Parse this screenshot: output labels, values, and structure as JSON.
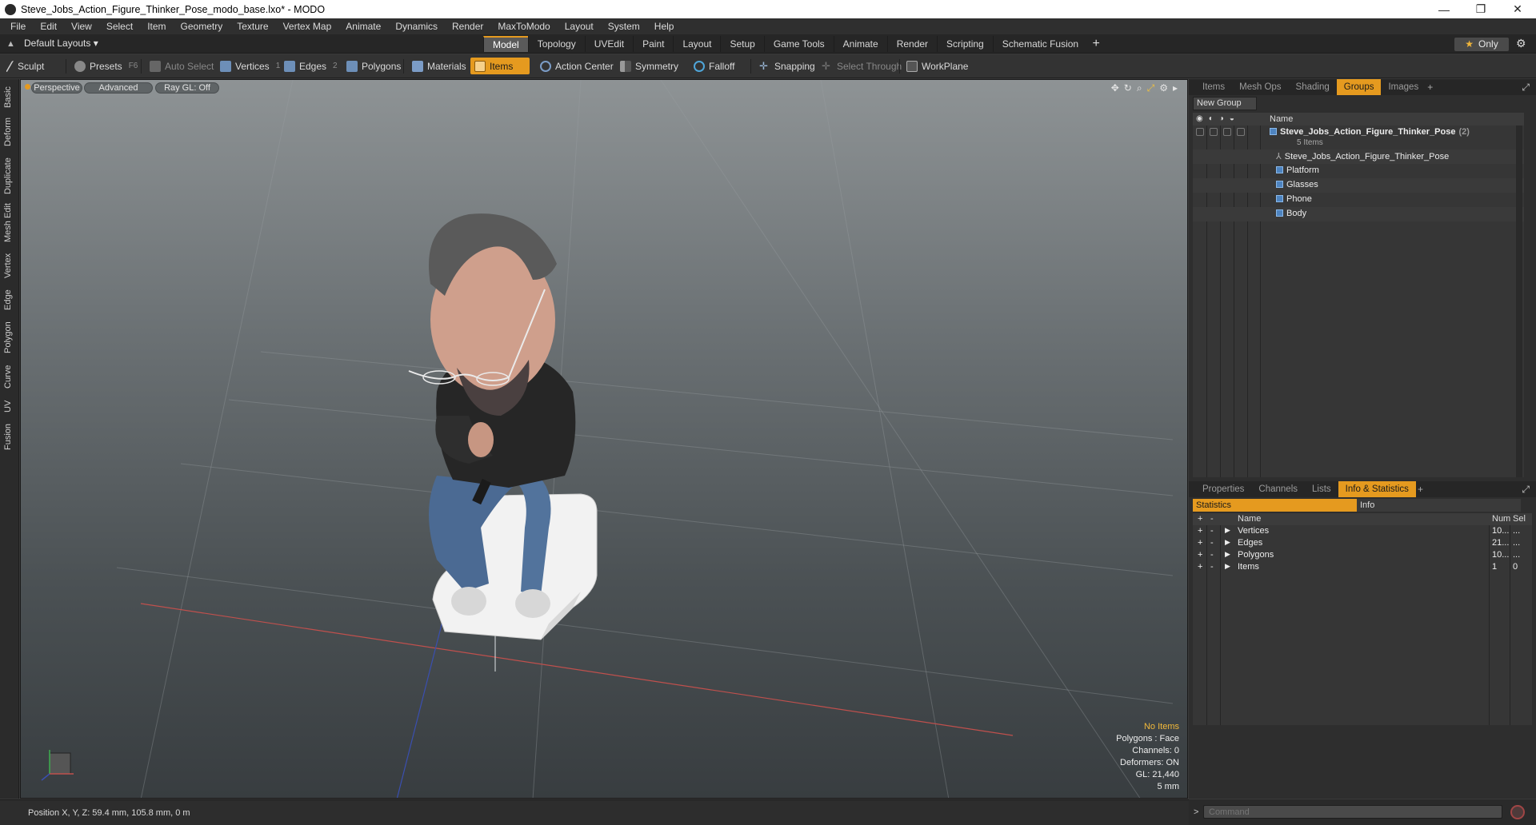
{
  "window": {
    "title": "Steve_Jobs_Action_Figure_Thinker_Pose_modo_base.lxo* - MODO",
    "controls": [
      "—",
      "❐",
      "✕"
    ]
  },
  "menu": [
    "File",
    "Edit",
    "View",
    "Select",
    "Item",
    "Geometry",
    "Texture",
    "Vertex Map",
    "Animate",
    "Dynamics",
    "Render",
    "MaxToModo",
    "Layout",
    "System",
    "Help"
  ],
  "layoutbar": {
    "layout_selector": "Default Layouts ▾",
    "tabs": [
      "Model",
      "Topology",
      "UVEdit",
      "Paint",
      "Layout",
      "Setup",
      "Game Tools",
      "Animate",
      "Render",
      "Scripting",
      "Schematic Fusion"
    ],
    "active_tab": "Model",
    "only_label": "Only"
  },
  "toolbar": {
    "sculpt": "Sculpt",
    "presets": "Presets",
    "presets_hotkey": "F6",
    "auto_select": "Auto Select",
    "vertices": "Vertices",
    "vertices_hotkey": "1",
    "edges": "Edges",
    "edges_hotkey": "2",
    "polygons": "Polygons",
    "materials": "Materials",
    "items": "Items",
    "action_center": "Action Center",
    "symmetry": "Symmetry",
    "falloff": "Falloff",
    "snapping": "Snapping",
    "select_through": "Select Through",
    "workplane": "WorkPlane"
  },
  "left_tabs": [
    "Basic",
    "Deform",
    "Duplicate",
    "Mesh Edit",
    "Vertex",
    "Edge",
    "Polygon",
    "Curve",
    "UV",
    "Fusion"
  ],
  "viewport": {
    "view_mode": "Perspective",
    "shading": "Advanced",
    "raygl": "Ray GL: Off",
    "hud": {
      "selection": "No Items",
      "polygons": "Polygons : Face",
      "channels": "Channels: 0",
      "deformers": "Deformers: ON",
      "gl": "GL: 21,440",
      "grid": "5 mm"
    }
  },
  "status": {
    "position": "Position X, Y, Z:   59.4 mm, 105.8 mm, 0 m"
  },
  "items_panel": {
    "tabs": [
      "Items",
      "Mesh Ops",
      "Shading",
      "Groups",
      "Images"
    ],
    "active_tab": "Groups",
    "new_group": "New Group",
    "column_name": "Name",
    "group": {
      "name": "Steve_Jobs_Action_Figure_Thinker_Pose",
      "count": "(2)",
      "sub": "5 Items"
    },
    "children": [
      "Steve_Jobs_Action_Figure_Thinker_Pose",
      "Platform",
      "Glasses",
      "Phone",
      "Body"
    ]
  },
  "stats_panel": {
    "tabs": [
      "Properties",
      "Channels",
      "Lists",
      "Info & Statistics"
    ],
    "active_tab": "Info & Statistics",
    "subtabs": [
      "Statistics",
      "Info"
    ],
    "columns": {
      "name": "Name",
      "num": "Num",
      "sel": "Sel"
    },
    "rows": [
      {
        "name": "Vertices",
        "num": "10...",
        "sel": "..."
      },
      {
        "name": "Edges",
        "num": "21...",
        "sel": "..."
      },
      {
        "name": "Polygons",
        "num": "10...",
        "sel": "..."
      },
      {
        "name": "Items",
        "num": "1",
        "sel": "0"
      }
    ]
  },
  "command": {
    "placeholder": "Command",
    "prompt": ">"
  },
  "colors": {
    "accent": "#e59a1f",
    "viewport_top": "#8e9395",
    "viewport_bottom": "#383d40"
  }
}
